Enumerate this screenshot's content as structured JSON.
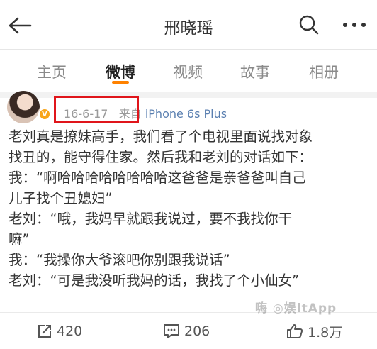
{
  "header": {
    "title": "邢晓瑶",
    "back_icon": "arrow-left-icon",
    "search_icon": "search-icon",
    "more_icon": "more-dots-icon"
  },
  "tabs": [
    {
      "label": "主页",
      "active": false
    },
    {
      "label": "微博",
      "active": true
    },
    {
      "label": "视频",
      "active": false
    },
    {
      "label": "故事",
      "active": false
    },
    {
      "label": "相册",
      "active": false
    }
  ],
  "accent_color": "#ff8200",
  "post": {
    "date": "16-6-17",
    "source_prefix": "来自",
    "source": "iPhone 6s Plus",
    "lines": [
      "老刘真是撩妹高手，我们看了个电视里面说找对象",
      "找丑的，能守得住家。然后我和老刘的对话如下：",
      "我：“啊哈哈哈哈哈哈哈哈这爸爸是亲爸爸叫自己",
      "儿子找个丑媳妇”",
      "老刘：“哦，我妈早就跟我说过，要不我找你干",
      "嘛”",
      "我：“我操你大爷滚吧你别跟我说话”",
      "老刘：“可是我没听我妈的话，我找了个小仙女”"
    ]
  },
  "actions": {
    "repost_count": "420",
    "comment_count": "206",
    "like_count": "1.8万"
  },
  "watermark": "嗨 ◎娱ltApp"
}
